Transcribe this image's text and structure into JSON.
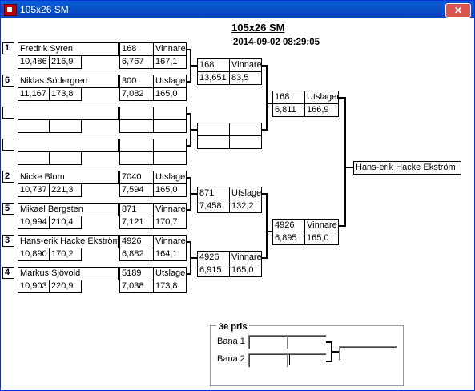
{
  "window": {
    "title": "105x26 SM",
    "close_label": "✕"
  },
  "header": {
    "title": "105x26 SM",
    "datetime": "2014-09-02 08:29:05"
  },
  "round1": [
    {
      "seed": "1",
      "name": "Fredrik Syren",
      "v1": "10,486",
      "v2": "216,9",
      "r_lane": "168",
      "r_result": "Vinnare",
      "r_time": "6,767",
      "r_speed": "167,1"
    },
    {
      "seed": "6",
      "name": "Niklas Södergren",
      "v1": "11,167",
      "v2": "173,8",
      "r_lane": "300",
      "r_result": "Utslagen",
      "r_time": "7,082",
      "r_speed": "165,0"
    },
    {
      "seed": "",
      "name": "",
      "v1": "",
      "v2": "",
      "r_lane": "",
      "r_result": "",
      "r_time": "",
      "r_speed": ""
    },
    {
      "seed": "",
      "name": "",
      "v1": "",
      "v2": "",
      "r_lane": "",
      "r_result": "",
      "r_time": "",
      "r_speed": ""
    },
    {
      "seed": "2",
      "name": "Nicke Blom",
      "v1": "10,737",
      "v2": "221,3",
      "r_lane": "7040",
      "r_result": "Utslagen",
      "r_time": "7,594",
      "r_speed": "165,0"
    },
    {
      "seed": "5",
      "name": "Mikael Bergsten",
      "v1": "10,994",
      "v2": "210,4",
      "r_lane": "871",
      "r_result": "Vinnare",
      "r_time": "7,121",
      "r_speed": "170,7"
    },
    {
      "seed": "3",
      "name": "Hans-erik Hacke Ekström",
      "v1": "10,890",
      "v2": "170,2",
      "r_lane": "4926",
      "r_result": "Vinnare",
      "r_time": "6,882",
      "r_speed": "164,1"
    },
    {
      "seed": "4",
      "name": "Markus Sjövold",
      "v1": "10,903",
      "v2": "220,9",
      "r_lane": "5189",
      "r_result": "Utslagen",
      "r_time": "7,038",
      "r_speed": "173,8"
    }
  ],
  "round2": [
    {
      "lane": "168",
      "result": "Vinnare",
      "time": "13,651",
      "speed": "83,5"
    },
    {
      "lane": "",
      "result": "",
      "time": "",
      "speed": ""
    },
    {
      "lane": "871",
      "result": "Utslagen",
      "time": "7,458",
      "speed": "132,2"
    },
    {
      "lane": "4926",
      "result": "Vinnare",
      "time": "6,915",
      "speed": "165,0"
    }
  ],
  "semis": [
    {
      "lane": "168",
      "result": "Utslagen",
      "time": "6,811",
      "speed": "166,9"
    },
    {
      "lane": "4926",
      "result": "Vinnare",
      "time": "6,895",
      "speed": "165,0"
    }
  ],
  "winner": "Hans-erik Hacke Ekström",
  "third_place": {
    "label": "3e pris",
    "bana1_label": "Bana 1",
    "bana2_label": "Bana 2",
    "bana1_a": "",
    "bana1_b": "",
    "bana2_a": "",
    "bana2_b": "",
    "result": ""
  }
}
